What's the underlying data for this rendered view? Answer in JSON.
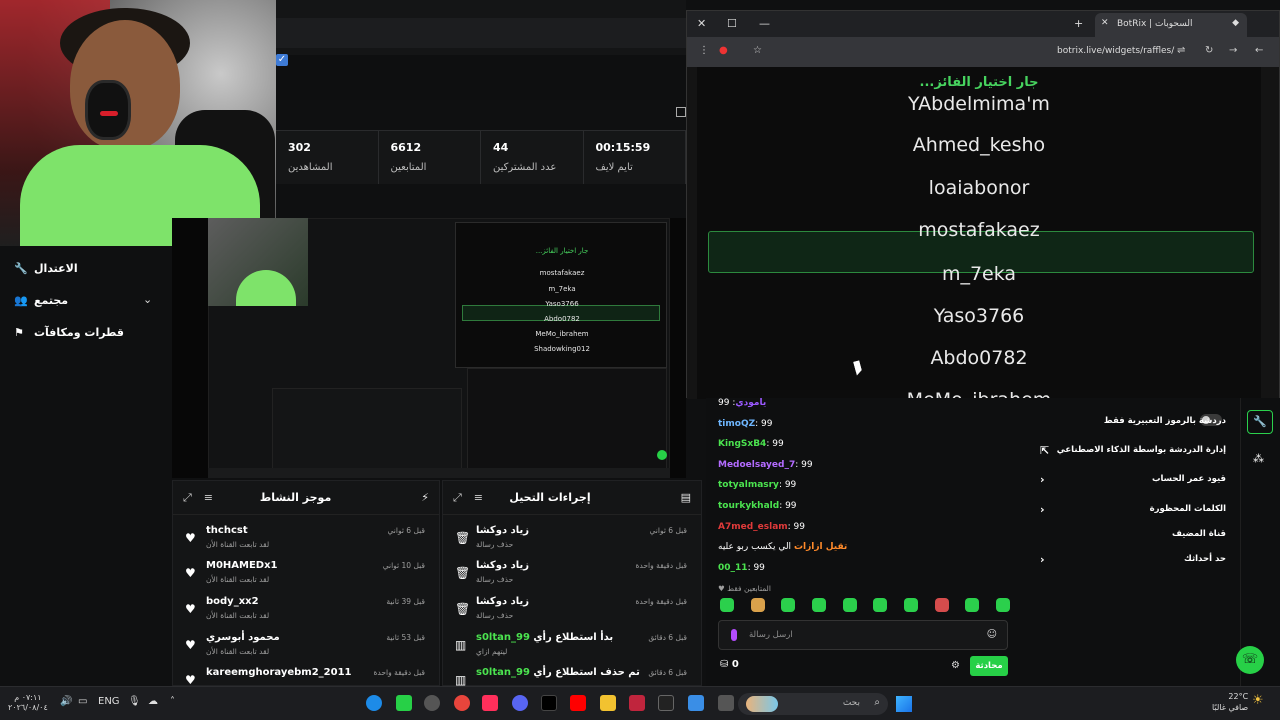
{
  "stats": [
    {
      "value": "302",
      "label": "المشاهدين"
    },
    {
      "value": "6612",
      "label": "المتابعين"
    },
    {
      "value": "44",
      "label": "عدد المشتركين"
    },
    {
      "value": "00:15:59",
      "label": "تايم لايف"
    }
  ],
  "sidebar": {
    "items": [
      {
        "label": "الاعتدال"
      },
      {
        "label": "مجتمع"
      },
      {
        "label": "قطرات ومكافآت"
      }
    ]
  },
  "activity": {
    "title": "موجز النشاط",
    "rows": [
      {
        "name": "thchcst",
        "sub": "لقد تابعت القناة الأن",
        "time": "قبل 6 ثواني"
      },
      {
        "name": "M0HAMEDx1",
        "sub": "لقد تابعت القناة الأن",
        "time": "قبل 10 ثواني"
      },
      {
        "name": "body_xx2",
        "sub": "لقد تابعت القناة الأن",
        "time": "قبل 39 ثانية"
      },
      {
        "name": "محمود أبوسري",
        "sub": "لقد تابعت القناة الأن",
        "time": "قبل 53 ثانية"
      },
      {
        "name": "kareemghorayebm2_2011",
        "sub": "",
        "time": "قبل دقيقة واحدة"
      }
    ]
  },
  "modactions": {
    "title": "إجراءات التحيل",
    "rows": [
      {
        "name": "زياد دوكشا",
        "sub": "حذف رسالة",
        "time": "قبل 6 ثواني"
      },
      {
        "name": "زياد دوكشا",
        "sub": "حذف رسالة",
        "time": "قبل دقيقة واحدة"
      },
      {
        "name": "زياد دوكشا",
        "sub": "حذف رسالة",
        "time": "قبل دقيقة واحدة"
      },
      {
        "name_user": "s0ltan_99",
        "name_rest": "بدأ استطلاع رأي",
        "sub": "ليتهم ازاي",
        "time": "قبل 6 دقائق"
      },
      {
        "name_user": "s0ltan_99",
        "name_rest": "تم حذف استطلاع رأي",
        "sub": "",
        "time": "قبل 6 دقائق"
      }
    ]
  },
  "browser": {
    "tab_title": "BotRix | السحوبات",
    "url": "botrix.live/widgets/raffles/",
    "widget_title": "...جار اختيار الفائز",
    "names": [
      "YAbdelmima'm",
      "Ahmed_kesho",
      "loaiabonor",
      "mostafakaez",
      "m_7eka",
      "Yaso3766",
      "Abdo0782",
      "MeMo_ibrahem"
    ]
  },
  "preview": {
    "title": "...جار اختيار الفائز",
    "names": [
      "mostafakaez",
      "m_7eka",
      "Yaso3766",
      "Abdo0782",
      "MeMo_ibrahem",
      "Shadowking012"
    ]
  },
  "chat": {
    "messages": [
      {
        "user": "يامودي",
        "text": ": 99",
        "color": "#9b59ff"
      },
      {
        "user": "timoQZ",
        "text": ": 99",
        "color": "#6fb7ff"
      },
      {
        "user": "KingSxB4",
        "text": ": 99",
        "color": "#4be34f"
      },
      {
        "user": "Medoelsayed_7",
        "text": ": 99",
        "color": "#b36bff"
      },
      {
        "user": "totyalmasry",
        "text": ": 99",
        "color": "#4be34f"
      },
      {
        "user": "tourkykhald",
        "text": ": 99",
        "color": "#4be34f"
      },
      {
        "user": "A7med_eslam",
        "text": ": 99",
        "color": "#e03a3a"
      },
      {
        "user": "تقيل ازازات",
        "text": "الي يكسب ربو عليه",
        "color": "#ff8a2a"
      },
      {
        "user": "00_11",
        "text": ": 99",
        "color": "#4be34f"
      }
    ],
    "note": "المتابعين فقط",
    "placeholder": "ارسل رسالة",
    "send": "محادثة",
    "points": "0"
  },
  "settings": {
    "items": [
      {
        "label": "دردشة بالرموز التعبيرية فقط"
      },
      {
        "label": "إدارة الدردشة بواسطة الذكاء الاصطناعي"
      },
      {
        "label": "قيود عمر الحساب"
      },
      {
        "label": "الكلمات المحظورة"
      },
      {
        "label": "قناة المضيف"
      },
      {
        "label": "حد أحداثك"
      }
    ]
  },
  "taskbar": {
    "time": "٠٧:١١ م",
    "date": "٢٠٢٦/٠٨/٠٤",
    "lang": "ENG",
    "search": "بحث",
    "weather_temp": "22°C",
    "weather_desc": "صافي غالبًا"
  }
}
